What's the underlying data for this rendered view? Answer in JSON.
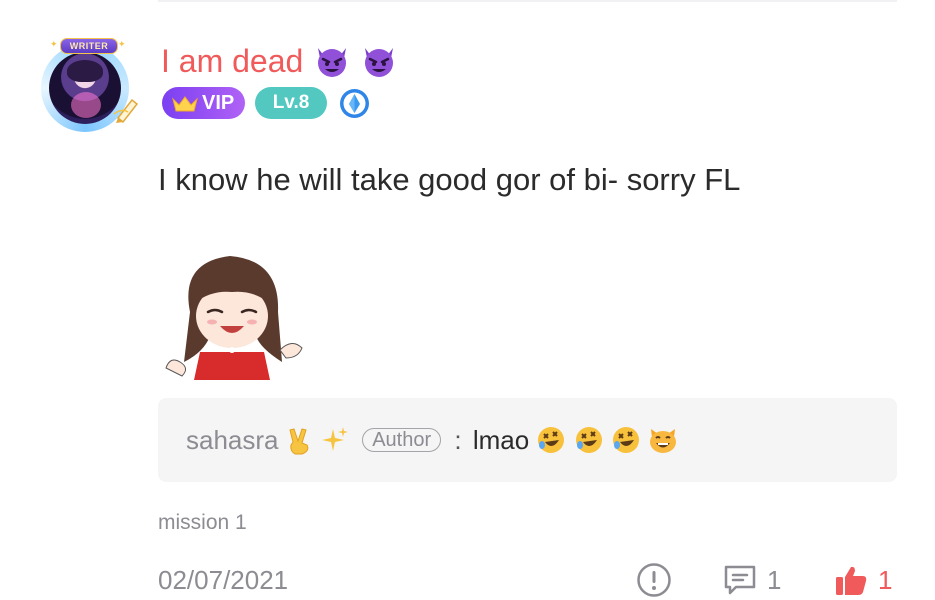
{
  "comment": {
    "username": "I am dead",
    "username_emojis": [
      "devil-emoji",
      "devil-emoji"
    ],
    "avatar_badge": "WRITER",
    "vip_label": "VIP",
    "level_label": "Lv.8",
    "text": "I know he will take good gor of bi- sorry FL",
    "sticker": "anime-girl-sticker",
    "mission": "mission 1",
    "date": "02/07/2021",
    "reply_count": "1",
    "like_count": "1"
  },
  "reply": {
    "user": "sahasra",
    "user_emojis": [
      "victory-hand-emoji",
      "sparkles-emoji"
    ],
    "author_tag": "Author",
    "separator": ":",
    "text": "lmao",
    "text_emojis": [
      "rofl-emoji",
      "rofl-emoji",
      "rofl-emoji",
      "grinning-cat-emoji"
    ]
  },
  "colors": {
    "username": "#f05a5a",
    "vip_start": "#7b3ff2",
    "vip_end": "#b062f5",
    "level": "#52c8c1",
    "muted": "#8c8c92",
    "reply_bg": "#f5f5f6",
    "like": "#f05a5a"
  }
}
